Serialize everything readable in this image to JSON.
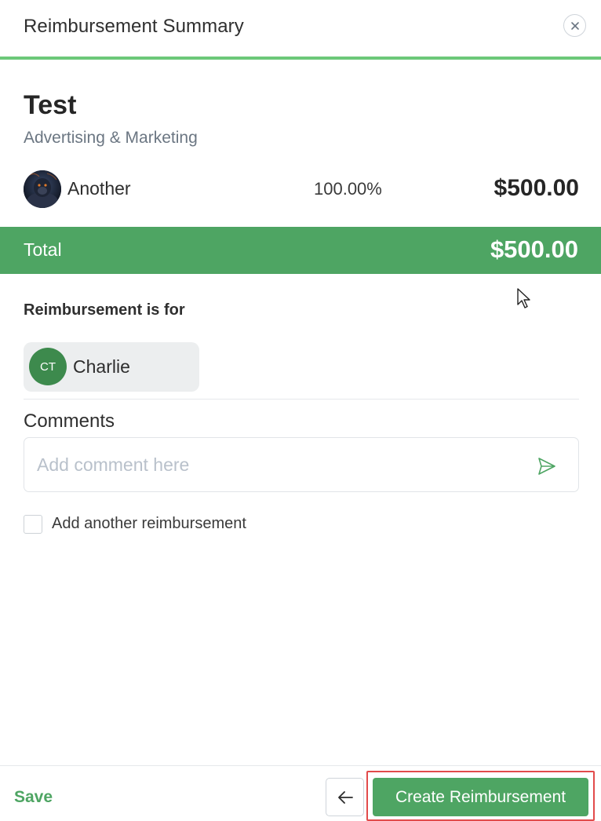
{
  "header": {
    "title": "Reimbursement Summary",
    "close_icon": "close-icon"
  },
  "expense": {
    "title": "Test",
    "category": "Advertising & Marketing",
    "allocation": {
      "name": "Another",
      "percentage": "100.00%",
      "amount": "$500.00"
    }
  },
  "total": {
    "label": "Total",
    "amount": "$500.00"
  },
  "reimbursement_for": {
    "label": "Reimbursement is for",
    "person": {
      "initials": "CT",
      "name": "Charlie"
    }
  },
  "comments": {
    "label": "Comments",
    "placeholder": "Add comment here",
    "value": "",
    "send_icon": "send-icon"
  },
  "add_another": {
    "label": "Add another reimbursement",
    "checked": false
  },
  "footer": {
    "save_label": "Save",
    "back_icon": "arrow-left-icon",
    "create_label": "Create Reimbursement"
  },
  "colors": {
    "accent_green": "#4ea563",
    "header_rule": "#6cc879",
    "avatar_green": "#3d8a4d",
    "highlight_red": "#e24b4b"
  }
}
